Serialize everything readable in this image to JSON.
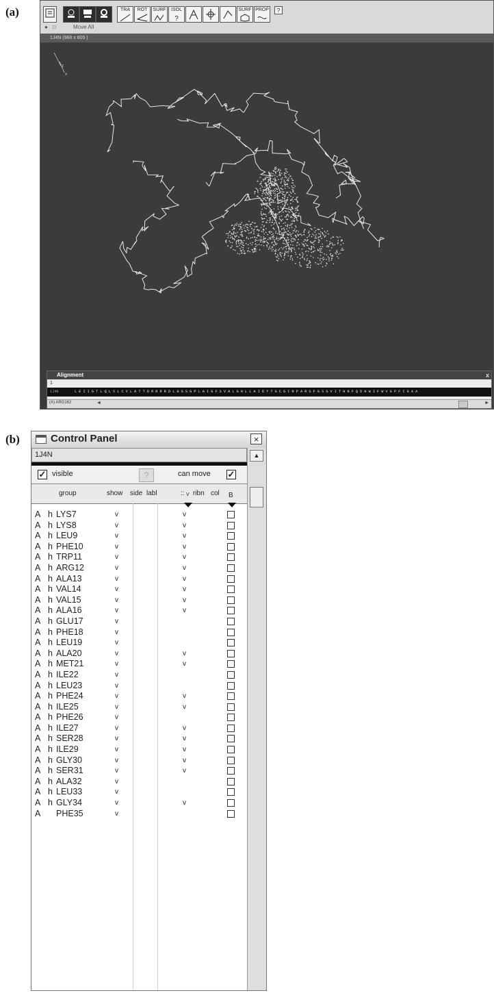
{
  "panel_a": {
    "label": "(a)",
    "toolbar": {
      "buttons": [
        "",
        "",
        "",
        "",
        "TRA",
        "ROT",
        "SURF",
        "ISOL",
        "",
        "",
        "",
        "SURF",
        "PROP"
      ],
      "small_text": "Move All",
      "help": "?"
    },
    "window_title": "1J4N (968 x 805 )",
    "axes": {
      "x": "x",
      "z": "z"
    },
    "alignment": {
      "title": "Alignment",
      "close": "x",
      "ruler_mark": "1",
      "seq_name": "1J4N",
      "sequence": "L E I I G T L Q L V L C V L A T T D R R R R D L G G S G P L A I G F S V A L G H L L A I D Y T G C G I N P A R S F G S S V I T H N F Q D H W I F W V G P F I G A A",
      "residue": "(A) ARG162",
      "scroll_left": "◄",
      "scroll_right": "►"
    }
  },
  "panel_b": {
    "label": "(b)",
    "title": "Control Panel",
    "close": "×",
    "model": "1J4N",
    "visible_label": "visible",
    "visible_checked": true,
    "help": "?",
    "can_move_label": "can move",
    "can_move_checked": true,
    "headers": {
      "group": "group",
      "show": "show",
      "side": "side",
      "labl": "labl",
      "dots": "::",
      "dots_sub": "V",
      "ribn": "ribn",
      "col": "col",
      "b": "B"
    },
    "rows": [
      {
        "chain": "A",
        "h": "h",
        "name": "LYS7",
        "show": "v",
        "dot": "v"
      },
      {
        "chain": "A",
        "h": "h",
        "name": "LYS8",
        "show": "v",
        "dot": "v"
      },
      {
        "chain": "A",
        "h": "h",
        "name": "LEU9",
        "show": "v",
        "dot": "v"
      },
      {
        "chain": "A",
        "h": "h",
        "name": "PHE10",
        "show": "v",
        "dot": "v"
      },
      {
        "chain": "A",
        "h": "h",
        "name": "TRP11",
        "show": "v",
        "dot": "v"
      },
      {
        "chain": "A",
        "h": "h",
        "name": "ARG12",
        "show": "v",
        "dot": "v"
      },
      {
        "chain": "A",
        "h": "h",
        "name": "ALA13",
        "show": "v",
        "dot": "v"
      },
      {
        "chain": "A",
        "h": "h",
        "name": "VAL14",
        "show": "v",
        "dot": "v"
      },
      {
        "chain": "A",
        "h": "h",
        "name": "VAL15",
        "show": "v",
        "dot": "v"
      },
      {
        "chain": "A",
        "h": "h",
        "name": "ALA16",
        "show": "v",
        "dot": "v"
      },
      {
        "chain": "A",
        "h": "h",
        "name": "GLU17",
        "show": "v",
        "dot": ""
      },
      {
        "chain": "A",
        "h": "h",
        "name": "PHE18",
        "show": "v",
        "dot": ""
      },
      {
        "chain": "A",
        "h": "h",
        "name": "LEU19",
        "show": "v",
        "dot": ""
      },
      {
        "chain": "A",
        "h": "h",
        "name": "ALA20",
        "show": "v",
        "dot": "v"
      },
      {
        "chain": "A",
        "h": "h",
        "name": "MET21",
        "show": "v",
        "dot": "v"
      },
      {
        "chain": "A",
        "h": "h",
        "name": "ILE22",
        "show": "v",
        "dot": ""
      },
      {
        "chain": "A",
        "h": "h",
        "name": "LEU23",
        "show": "v",
        "dot": ""
      },
      {
        "chain": "A",
        "h": "h",
        "name": "PHE24",
        "show": "v",
        "dot": "v"
      },
      {
        "chain": "A",
        "h": "h",
        "name": "ILE25",
        "show": "v",
        "dot": "v"
      },
      {
        "chain": "A",
        "h": "h",
        "name": "PHE26",
        "show": "v",
        "dot": ""
      },
      {
        "chain": "A",
        "h": "h",
        "name": "ILE27",
        "show": "v",
        "dot": "v"
      },
      {
        "chain": "A",
        "h": "h",
        "name": "SER28",
        "show": "v",
        "dot": "v"
      },
      {
        "chain": "A",
        "h": "h",
        "name": "ILE29",
        "show": "v",
        "dot": "v"
      },
      {
        "chain": "A",
        "h": "h",
        "name": "GLY30",
        "show": "v",
        "dot": "v"
      },
      {
        "chain": "A",
        "h": "h",
        "name": "SER31",
        "show": "v",
        "dot": "v"
      },
      {
        "chain": "A",
        "h": "h",
        "name": "ALA32",
        "show": "v",
        "dot": ""
      },
      {
        "chain": "A",
        "h": "h",
        "name": "LEU33",
        "show": "v",
        "dot": ""
      },
      {
        "chain": "A",
        "h": "h",
        "name": "GLY34",
        "show": "v",
        "dot": "v"
      },
      {
        "chain": "A",
        "h": "",
        "name": "PHE35",
        "show": "v",
        "dot": ""
      }
    ]
  }
}
